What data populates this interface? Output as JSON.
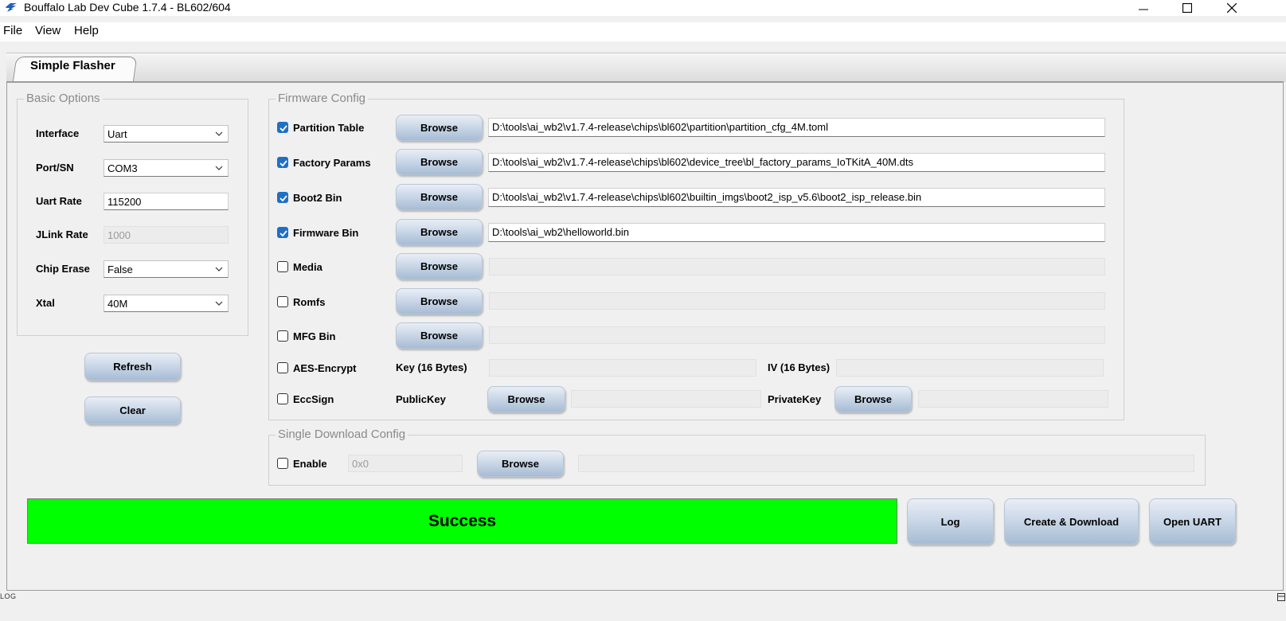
{
  "window": {
    "title": "Bouffalo Lab Dev Cube 1.7.4 - BL602/604",
    "icon": "bouffalo-logo-icon"
  },
  "menu": [
    "File",
    "View",
    "Help"
  ],
  "tabs": [
    {
      "label": "Simple Flasher",
      "active": true
    }
  ],
  "basic_options": {
    "title": "Basic Options",
    "interface": {
      "label": "Interface",
      "value": "Uart"
    },
    "port": {
      "label": "Port/SN",
      "value": "COM3"
    },
    "uart_rate": {
      "label": "Uart Rate",
      "value": "115200"
    },
    "jlink_rate": {
      "label": "JLink Rate",
      "value": "1000"
    },
    "chip_erase": {
      "label": "Chip Erase",
      "value": "False"
    },
    "xtal": {
      "label": "Xtal",
      "value": "40M"
    },
    "refresh_label": "Refresh",
    "clear_label": "Clear"
  },
  "firmware": {
    "title": "Firmware Config",
    "browse_label": "Browse",
    "rows": [
      {
        "label": "Partition Table",
        "checked": true,
        "path": "D:\\tools\\ai_wb2\\v1.7.4-release\\chips\\bl602\\partition\\partition_cfg_4M.toml"
      },
      {
        "label": "Factory Params",
        "checked": true,
        "path": "D:\\tools\\ai_wb2\\v1.7.4-release\\chips\\bl602\\device_tree\\bl_factory_params_IoTKitA_40M.dts"
      },
      {
        "label": "Boot2 Bin",
        "checked": true,
        "path": "D:\\tools\\ai_wb2\\v1.7.4-release\\chips\\bl602\\builtin_imgs\\boot2_isp_v5.6\\boot2_isp_release.bin"
      },
      {
        "label": "Firmware Bin",
        "checked": true,
        "path": "D:\\tools\\ai_wb2\\helloworld.bin"
      },
      {
        "label": "Media",
        "checked": false,
        "path": ""
      },
      {
        "label": "Romfs",
        "checked": false,
        "path": ""
      },
      {
        "label": "MFG Bin",
        "checked": false,
        "path": ""
      }
    ],
    "aes": {
      "label": "AES-Encrypt",
      "checked": false,
      "key_label": "Key (16 Bytes)",
      "iv_label": "IV (16 Bytes)"
    },
    "eccsign": {
      "label": "EccSign",
      "checked": false,
      "public_label": "PublicKey",
      "private_label": "PrivateKey"
    }
  },
  "single_download": {
    "title": "Single Download Config",
    "enable_label": "Enable",
    "checked": false,
    "address": "0x0",
    "browse_label": "Browse"
  },
  "status": {
    "text": "Success",
    "color": "#00ff00"
  },
  "actions": {
    "log": "Log",
    "create_download": "Create & Download",
    "open_uart": "Open UART"
  },
  "statusbar": {
    "text": "LOG"
  }
}
